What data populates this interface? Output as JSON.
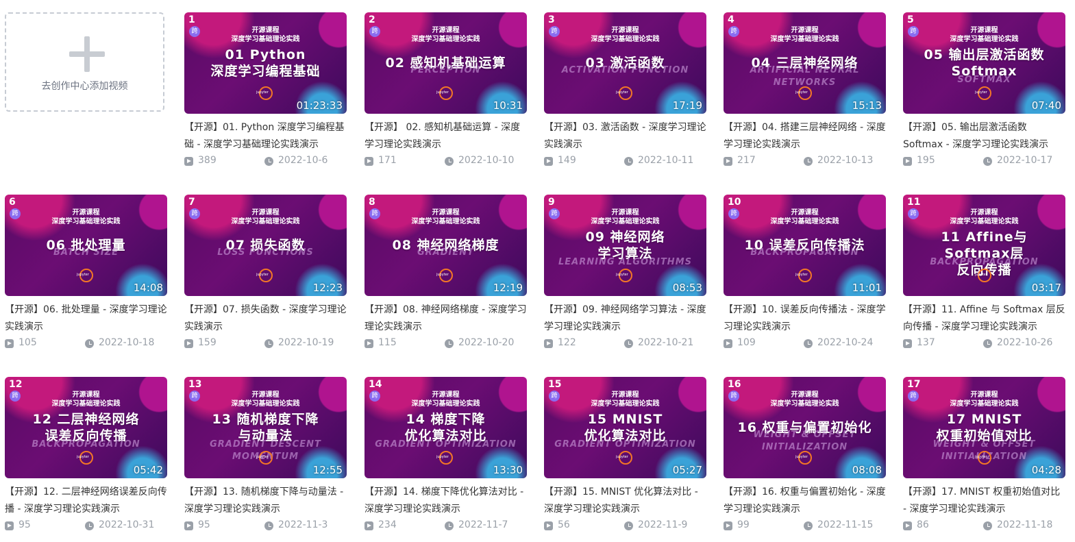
{
  "add_card": {
    "label": "去创作中心添加视频"
  },
  "course_label_1": "开源课程",
  "course_label_2": "深度学习基础理论实践",
  "videos": [
    {
      "idx": "1",
      "big": "01 Python\n深度学习编程基础",
      "sub": "",
      "duration": "01:23:33",
      "title": "【开源】01. Python 深度学习编程基础 - 深度学习基础理论实践演示",
      "views": "389",
      "date": "2022-10-6"
    },
    {
      "idx": "2",
      "big": "02 感知机基础运算",
      "sub": "PERCEPTION",
      "duration": "10:31",
      "title": "【开源】 02. 感知机基础运算 - 深度学习理论实践演示",
      "views": "171",
      "date": "2022-10-10"
    },
    {
      "idx": "3",
      "big": "03 激活函数",
      "sub": "ACTIVATION FUNCTION",
      "duration": "17:19",
      "title": "【开源】03. 激活函数 - 深度学习理论实践演示",
      "views": "149",
      "date": "2022-10-11"
    },
    {
      "idx": "4",
      "big": "04 三层神经网络",
      "sub": "ARTIFICIAL NEURAL\nNETWORKS",
      "duration": "15:13",
      "title": "【开源】04. 搭建三层神经网络 - 深度学习理论实践演示",
      "views": "217",
      "date": "2022-10-13"
    },
    {
      "idx": "5",
      "big": "05 输出层激活函数\nSoftmax",
      "sub": "SOFTMAX",
      "duration": "07:40",
      "title": "【开源】05. 输出层激活函数 Softmax - 深度学习理论实践演示",
      "views": "195",
      "date": "2022-10-17"
    },
    {
      "idx": "6",
      "big": "06 批处理量",
      "sub": "BATCH SIZE",
      "duration": "14:08",
      "title": "【开源】06. 批处理量 - 深度学习理论实践演示",
      "views": "105",
      "date": "2022-10-18"
    },
    {
      "idx": "7",
      "big": "07 损失函数",
      "sub": "LOSS FUNCTIONS",
      "duration": "12:23",
      "title": "【开源】07. 损失函数 - 深度学习理论实践演示",
      "views": "159",
      "date": "2022-10-19"
    },
    {
      "idx": "8",
      "big": "08 神经网络梯度",
      "sub": "GRADIENT",
      "duration": "12:19",
      "title": "【开源】08. 神经网络梯度 - 深度学习理论实践演示",
      "views": "115",
      "date": "2022-10-20"
    },
    {
      "idx": "9",
      "big": "09 神经网络\n学习算法",
      "sub": "LEARNING ALGORITHMS",
      "duration": "08:53",
      "title": "【开源】09. 神经网络学习算法 - 深度学习理论实践演示",
      "views": "122",
      "date": "2022-10-21"
    },
    {
      "idx": "10",
      "big": "10 误差反向传播法",
      "sub": "BACKPROPAGATION",
      "duration": "11:01",
      "title": "【开源】10. 误差反向传播法 - 深度学习理论实践演示",
      "views": "109",
      "date": "2022-10-24"
    },
    {
      "idx": "11",
      "big": "11 Affine与Softmax层\n反向传播",
      "sub": "BACKPROPAGATION",
      "duration": "03:17",
      "title": "【开源】11. Affine 与 Softmax 层反向传播 - 深度学习理论实践演示",
      "views": "137",
      "date": "2022-10-26"
    },
    {
      "idx": "12",
      "big": "12 二层神经网络\n误差反向传播",
      "sub": "BACKPROPAGATION",
      "duration": "05:42",
      "title": "【开源】12. 二层神经网络误差反向传播 - 深度学习理论实践演示",
      "views": "95",
      "date": "2022-10-31"
    },
    {
      "idx": "13",
      "big": "13 随机梯度下降\n与动量法",
      "sub": "GRADIENT DESCENT\nMOMENTUM",
      "duration": "12:55",
      "title": "【开源】13. 随机梯度下降与动量法 - 深度学习理论实践演示",
      "views": "95",
      "date": "2022-11-3"
    },
    {
      "idx": "14",
      "big": "14 梯度下降\n优化算法对比",
      "sub": "GRADIENT OPTIMIZATION",
      "duration": "13:30",
      "title": "【开源】14. 梯度下降优化算法对比 - 深度学习理论实践演示",
      "views": "234",
      "date": "2022-11-7"
    },
    {
      "idx": "15",
      "big": "15 MNIST\n优化算法对比",
      "sub": "GRADIENT OPTIMIZATION",
      "duration": "05:27",
      "title": "【开源】15. MNIST 优化算法对比 - 深度学习理论实践演示",
      "views": "56",
      "date": "2022-11-9"
    },
    {
      "idx": "16",
      "big": "16 权重与偏置初始化",
      "sub": "WEIGHT & OFFSET\nINITIALIZATION",
      "duration": "08:08",
      "title": "【开源】16. 权重与偏置初始化 - 深度学习理论实践演示",
      "views": "99",
      "date": "2022-11-15"
    },
    {
      "idx": "17",
      "big": "17 MNIST\n权重初始值对比",
      "sub": "WEIGHT & OFFSET\nINITIALIZATION",
      "duration": "04:28",
      "title": "【开源】17. MNIST 权重初始值对比 - 深度学习理论实践演示",
      "views": "86",
      "date": "2022-11-18"
    }
  ]
}
